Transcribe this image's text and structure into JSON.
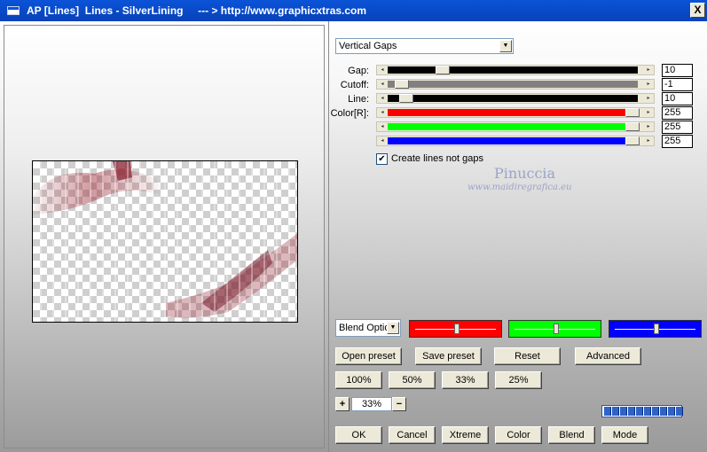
{
  "window": {
    "title": "AP [Lines]  Lines - SilverLining     --- > http://www.graphicxtras.com",
    "close_label": "X"
  },
  "mode_select": {
    "value": "Vertical Gaps"
  },
  "sliders": [
    {
      "label": "Gap:",
      "value": "10",
      "color": "#000000",
      "level": 0.2
    },
    {
      "label": "Cutoff:",
      "value": "-1",
      "color": "#808080",
      "level": 0.03
    },
    {
      "label": "Line:",
      "value": "10",
      "color": "#000000",
      "level": 0.05
    },
    {
      "label": "Color[R]:",
      "value": "255",
      "color": "#ff0000",
      "level": 1.0
    },
    {
      "label": "",
      "value": "255",
      "color": "#00ff00",
      "level": 1.0
    },
    {
      "label": "",
      "value": "255",
      "color": "#0000ff",
      "level": 1.0
    }
  ],
  "create_lines_checkbox": {
    "label": "Create lines not gaps",
    "checked": true
  },
  "watermark": {
    "name": "Pinuccia",
    "url": "www.maidiregrafica.eu"
  },
  "blend_select": {
    "value": "Blend Optio"
  },
  "color_boxes": [
    {
      "name": "red",
      "color": "#ff0000",
      "level": 0.5
    },
    {
      "name": "green",
      "color": "#00ff00",
      "level": 0.5
    },
    {
      "name": "blue",
      "color": "#0000ff",
      "level": 0.5
    }
  ],
  "preset_buttons": {
    "open": "Open preset",
    "save": "Save preset",
    "reset": "Reset",
    "advanced": "Advanced"
  },
  "zoom_buttons": [
    "100%",
    "50%",
    "33%",
    "25%"
  ],
  "zoom": {
    "plus": "+",
    "minus": "−",
    "value": "33%"
  },
  "bottom_buttons": {
    "ok": "OK",
    "cancel": "Cancel",
    "xtreme": "Xtreme",
    "color": "Color",
    "blend": "Blend",
    "mode": "Mode"
  },
  "progress": {
    "filled_cells": 10
  }
}
